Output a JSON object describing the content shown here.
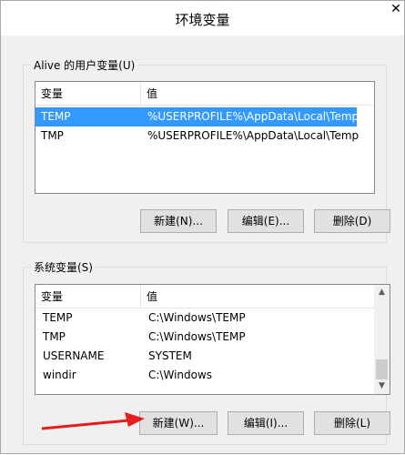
{
  "window": {
    "title": "环境变量",
    "close_glyph": "✕"
  },
  "user_vars": {
    "group_label": "Alive 的用户变量(U)",
    "columns": [
      "变量",
      "值"
    ],
    "rows": [
      {
        "name": "TEMP",
        "value": "%USERPROFILE%\\AppData\\Local\\Temp"
      },
      {
        "name": "TMP",
        "value": "%USERPROFILE%\\AppData\\Local\\Temp"
      }
    ],
    "selected_index": 0,
    "buttons": {
      "new": "新建(N)...",
      "edit": "编辑(E)...",
      "delete": "删除(D)"
    }
  },
  "system_vars": {
    "group_label": "系统变量(S)",
    "columns": [
      "变量",
      "值"
    ],
    "rows": [
      {
        "name": "TEMP",
        "value": "C:\\Windows\\TEMP"
      },
      {
        "name": "TMP",
        "value": "C:\\Windows\\TEMP"
      },
      {
        "name": "USERNAME",
        "value": "SYSTEM"
      },
      {
        "name": "windir",
        "value": "C:\\Windows"
      }
    ],
    "buttons": {
      "new": "新建(W)...",
      "edit": "编辑(I)...",
      "delete": "删除(L)"
    }
  },
  "annotation": {
    "arrow_color": "#e81c1c"
  },
  "colors": {
    "selection": "#3399ff",
    "window_bg": "#f0f0f0"
  }
}
